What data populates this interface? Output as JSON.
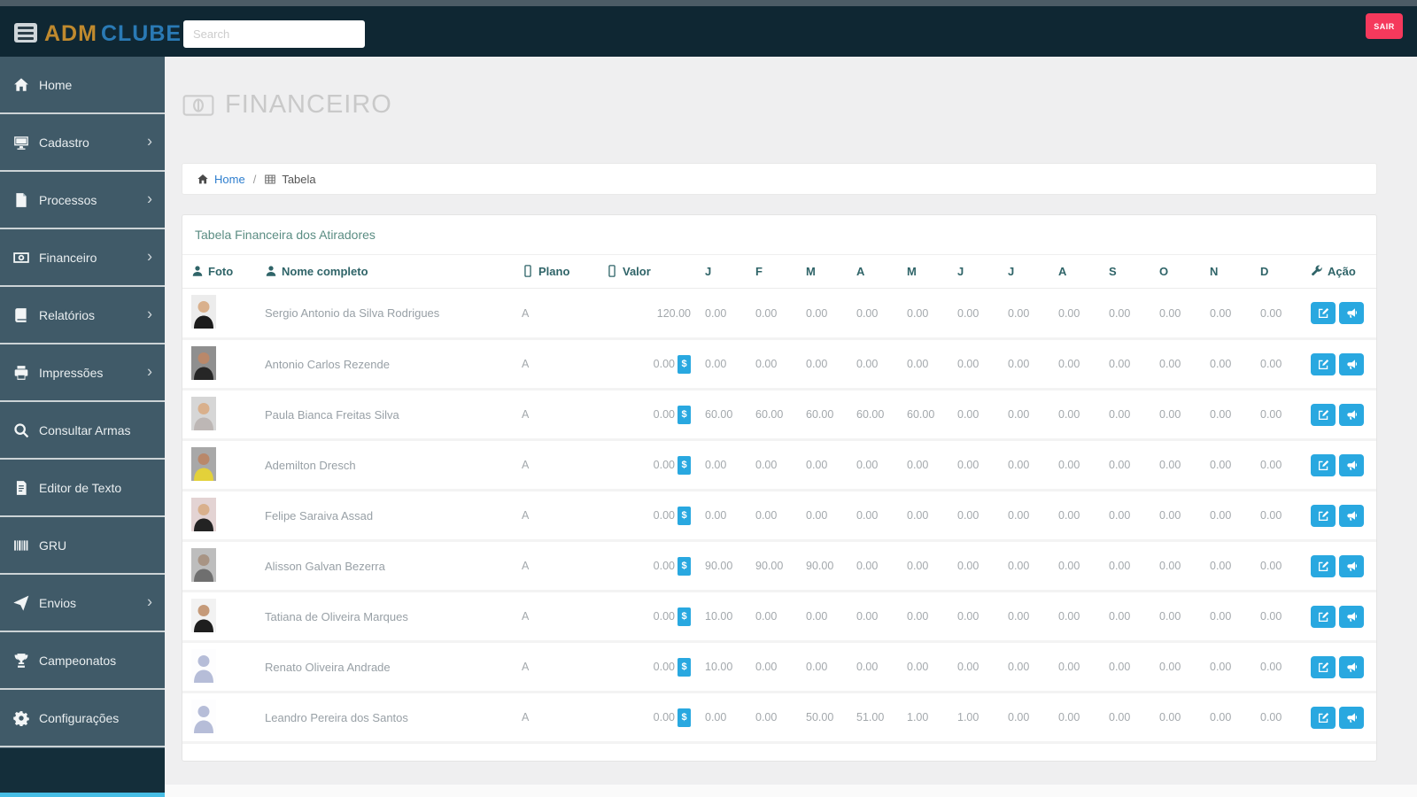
{
  "topbar": {
    "logo_adm": "ADM",
    "logo_clube": "CLUBE",
    "search_placeholder": "Search",
    "logout_label": "SAIR"
  },
  "colors": {
    "topbar_bg": "#0f2733",
    "sidebar_bg": "#405a68",
    "accent_blue": "#29a8e0",
    "logout_red": "#f5395c",
    "logo_gold": "#c08a2e",
    "logo_blue": "#2a7ab5",
    "link_blue": "#2e7ece",
    "header_teal": "#2f6468"
  },
  "sidebar": {
    "items": [
      {
        "label": "Home",
        "icon": "home-icon",
        "has_submenu": false
      },
      {
        "label": "Cadastro",
        "icon": "desktop-icon",
        "has_submenu": true
      },
      {
        "label": "Processos",
        "icon": "file-icon",
        "has_submenu": true
      },
      {
        "label": "Financeiro",
        "icon": "money-icon",
        "has_submenu": true
      },
      {
        "label": "Relatórios",
        "icon": "book-icon",
        "has_submenu": true
      },
      {
        "label": "Impressões",
        "icon": "printer-icon",
        "has_submenu": true
      },
      {
        "label": "Consultar Armas",
        "icon": "search-icon",
        "has_submenu": false
      },
      {
        "label": "Editor de Texto",
        "icon": "file-text-icon",
        "has_submenu": false
      },
      {
        "label": "GRU",
        "icon": "barcode-icon",
        "has_submenu": false
      },
      {
        "label": "Envios",
        "icon": "paper-plane-icon",
        "has_submenu": true
      },
      {
        "label": "Campeonatos",
        "icon": "trophy-icon",
        "has_submenu": false
      },
      {
        "label": "Configurações",
        "icon": "gear-icon",
        "has_submenu": false
      }
    ]
  },
  "page": {
    "title": "FINANCEIRO",
    "breadcrumb": {
      "home": "Home",
      "separator": "/",
      "current": "Tabela"
    }
  },
  "table": {
    "card_title": "Tabela Financeira dos Atiradores",
    "valor_badge": "$",
    "columns": [
      {
        "label": "Foto",
        "icon": "user-icon"
      },
      {
        "label": "Nome completo",
        "icon": "user-icon"
      },
      {
        "label": "Plano",
        "icon": "mobile-icon"
      },
      {
        "label": "Valor",
        "icon": "mobile-icon"
      },
      {
        "label": "J"
      },
      {
        "label": "F"
      },
      {
        "label": "M"
      },
      {
        "label": "A"
      },
      {
        "label": "M"
      },
      {
        "label": "J"
      },
      {
        "label": "J"
      },
      {
        "label": "A"
      },
      {
        "label": "S"
      },
      {
        "label": "O"
      },
      {
        "label": "N"
      },
      {
        "label": "D"
      },
      {
        "label": "Ação",
        "icon": "wrench-icon"
      }
    ],
    "rows": [
      {
        "name": "Sergio Antonio da Silva Rodrigues",
        "plano": "A",
        "valor": "120.00",
        "has_badge": false,
        "months": [
          "0.00",
          "0.00",
          "0.00",
          "0.00",
          "0.00",
          "0.00",
          "0.00",
          "0.00",
          "0.00",
          "0.00",
          "0.00",
          "0.00"
        ],
        "avatar": {
          "type": "photo",
          "bg": "#ececec",
          "skin": "#d9b08c",
          "shirt": "#1b1b1b"
        }
      },
      {
        "name": "Antonio Carlos Rezende",
        "plano": "A",
        "valor": "0.00",
        "has_badge": true,
        "months": [
          "0.00",
          "0.00",
          "0.00",
          "0.00",
          "0.00",
          "0.00",
          "0.00",
          "0.00",
          "0.00",
          "0.00",
          "0.00",
          "0.00"
        ],
        "avatar": {
          "type": "photo",
          "bg": "#8f8f8f",
          "skin": "#b9886a",
          "shirt": "#262626"
        }
      },
      {
        "name": "Paula Bianca Freitas Silva",
        "plano": "A",
        "valor": "0.00",
        "has_badge": true,
        "months": [
          "60.00",
          "60.00",
          "60.00",
          "60.00",
          "60.00",
          "0.00",
          "0.00",
          "0.00",
          "0.00",
          "0.00",
          "0.00",
          "0.00"
        ],
        "avatar": {
          "type": "photo",
          "bg": "#d6d6d6",
          "skin": "#d9b08c",
          "shirt": "#bdb7b5"
        }
      },
      {
        "name": "Ademilton Dresch",
        "plano": "A",
        "valor": "0.00",
        "has_badge": true,
        "months": [
          "0.00",
          "0.00",
          "0.00",
          "0.00",
          "0.00",
          "0.00",
          "0.00",
          "0.00",
          "0.00",
          "0.00",
          "0.00",
          "0.00"
        ],
        "avatar": {
          "type": "photo",
          "bg": "#a8a8a8",
          "skin": "#b9886a",
          "shirt": "#e3d13a"
        }
      },
      {
        "name": "Felipe Saraiva Assad",
        "plano": "A",
        "valor": "0.00",
        "has_badge": true,
        "months": [
          "0.00",
          "0.00",
          "0.00",
          "0.00",
          "0.00",
          "0.00",
          "0.00",
          "0.00",
          "0.00",
          "0.00",
          "0.00",
          "0.00"
        ],
        "avatar": {
          "type": "photo",
          "bg": "#e3d3d3",
          "skin": "#d9b08c",
          "shirt": "#232323"
        }
      },
      {
        "name": "Alisson Galvan Bezerra",
        "plano": "A",
        "valor": "0.00",
        "has_badge": true,
        "months": [
          "90.00",
          "90.00",
          "90.00",
          "0.00",
          "0.00",
          "0.00",
          "0.00",
          "0.00",
          "0.00",
          "0.00",
          "0.00",
          "0.00"
        ],
        "avatar": {
          "type": "photo",
          "bg": "#bdbdbd",
          "skin": "#a89484",
          "shirt": "#6f6f6f"
        }
      },
      {
        "name": "Tatiana de Oliveira Marques",
        "plano": "A",
        "valor": "0.00",
        "has_badge": true,
        "months": [
          "10.00",
          "0.00",
          "0.00",
          "0.00",
          "0.00",
          "0.00",
          "0.00",
          "0.00",
          "0.00",
          "0.00",
          "0.00",
          "0.00"
        ],
        "avatar": {
          "type": "photo",
          "bg": "#f2f2f2",
          "skin": "#c59a79",
          "shirt": "#1e1e1e"
        }
      },
      {
        "name": "Renato Oliveira Andrade",
        "plano": "A",
        "valor": "0.00",
        "has_badge": true,
        "months": [
          "10.00",
          "0.00",
          "0.00",
          "0.00",
          "0.00",
          "0.00",
          "0.00",
          "0.00",
          "0.00",
          "0.00",
          "0.00",
          "0.00"
        ],
        "avatar": {
          "type": "silhouette",
          "bg": "#fdfdfe",
          "skin": "#b6bdd8",
          "shirt": "#b6bdd8"
        }
      },
      {
        "name": "Leandro Pereira dos Santos",
        "plano": "A",
        "valor": "0.00",
        "has_badge": true,
        "months": [
          "0.00",
          "0.00",
          "50.00",
          "51.00",
          "1.00",
          "1.00",
          "0.00",
          "0.00",
          "0.00",
          "0.00",
          "0.00",
          "0.00"
        ],
        "avatar": {
          "type": "silhouette",
          "bg": "#fdfdfe",
          "skin": "#b6bdd8",
          "shirt": "#b6bdd8"
        }
      }
    ]
  }
}
